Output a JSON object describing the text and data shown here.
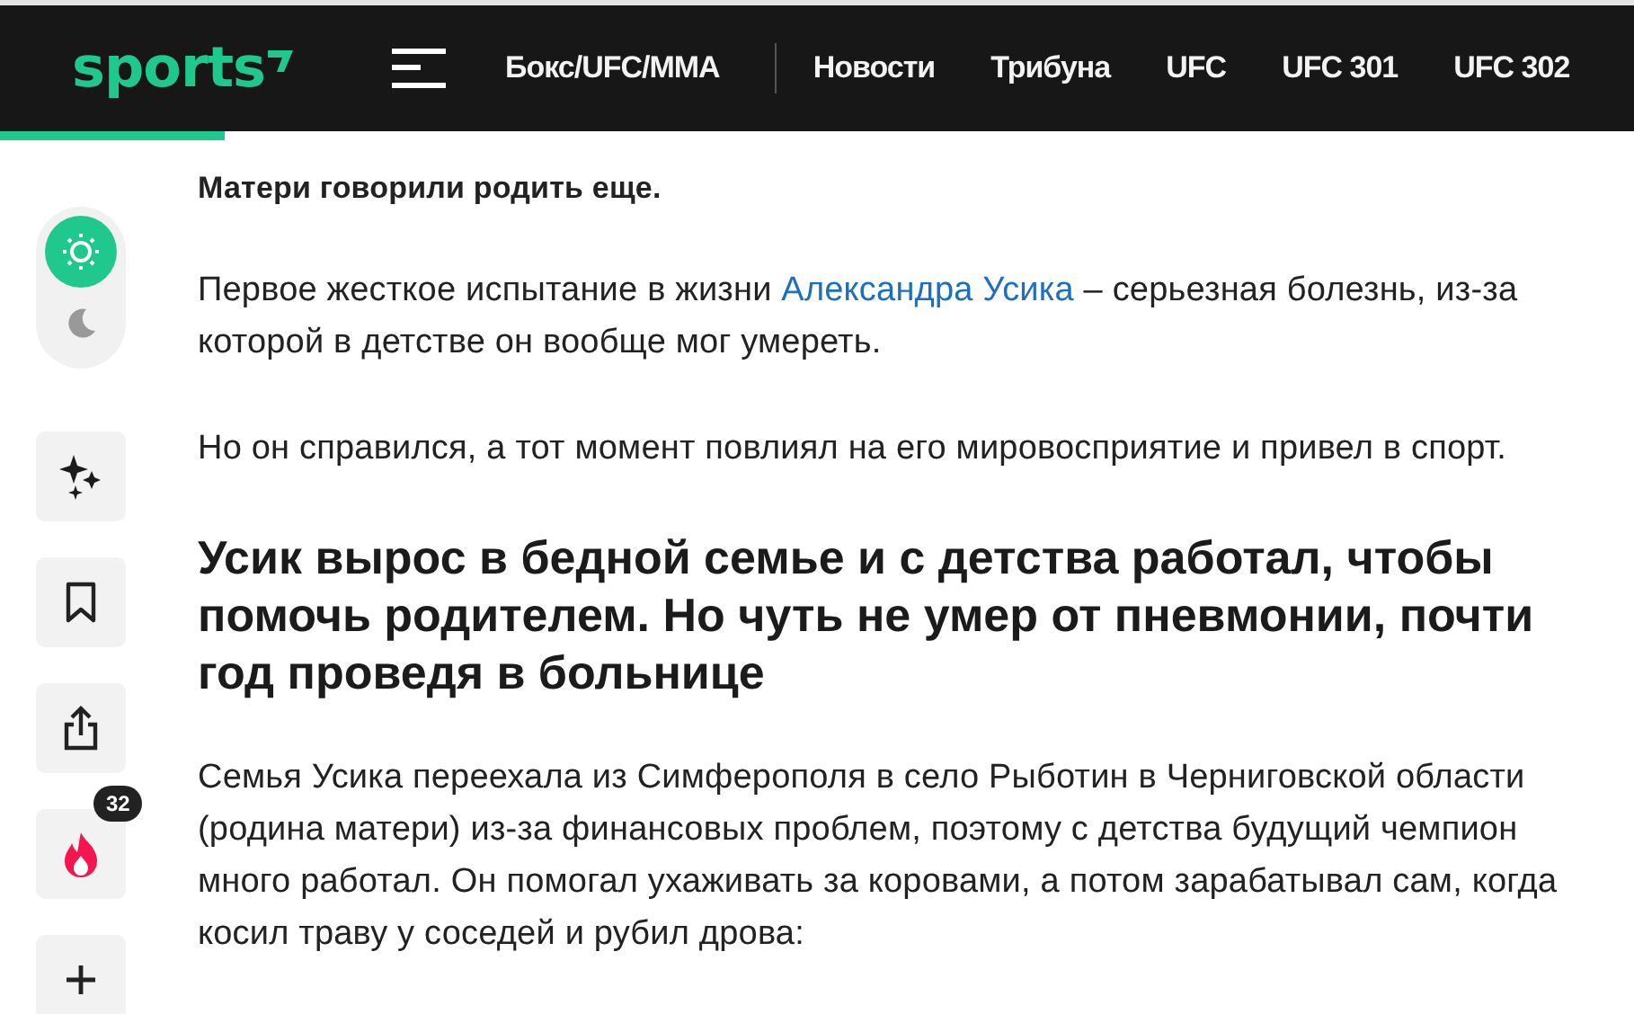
{
  "header": {
    "logo": "sports",
    "nav": [
      {
        "label": "Бокс/UFC/MMA",
        "selected": false
      },
      {
        "label": "Новости",
        "selected": false
      },
      {
        "label": "Трибуна",
        "selected": false
      },
      {
        "label": "UFC",
        "selected": false
      },
      {
        "label": "UFC 301",
        "selected": false
      },
      {
        "label": "UFC 302",
        "selected": false
      }
    ],
    "reading_progress": {
      "level": 0.138
    }
  },
  "sidebar": {
    "theme": [
      {
        "kind": "light",
        "selected": true
      },
      {
        "kind": "dark",
        "selected": false
      }
    ],
    "actions": [
      {
        "kind": "sparkle"
      },
      {
        "kind": "bookmark"
      },
      {
        "kind": "share"
      },
      {
        "kind": "fire",
        "count": "32"
      },
      {
        "kind": "plus"
      }
    ]
  },
  "article": [
    {
      "kind": "lead",
      "parts": [
        {
          "text": "Матери говорили родить еще."
        }
      ]
    },
    {
      "kind": "paragraph",
      "parts": [
        {
          "text": "Первое жесткое испытание в жизни "
        },
        {
          "text": "Александра Усика",
          "link": true
        },
        {
          "text": " – серьезная болезнь, из-за которой в детстве он вообще мог умереть."
        }
      ]
    },
    {
      "kind": "paragraph",
      "parts": [
        {
          "text": "Но он справился, а тот момент повлиял на его мировосприятие и привел в спорт."
        }
      ]
    },
    {
      "kind": "heading",
      "parts": [
        {
          "text": "Усик вырос в бедной семье и с детства работал, чтобы помочь родителем. Но чуть не умер от пневмонии, почти год проведя в больнице"
        }
      ]
    },
    {
      "kind": "paragraph",
      "parts": [
        {
          "text": "Семья Усика переехала из Симферополя в село Рыботин в Черниговской области (родина матери) из-за финансовых проблем, поэтому с детства будущий чемпион много работал. Он помогал ухаживать за коровами, а потом зарабатывал сам, когда косил траву у соседей и рубил дрова:"
        }
      ]
    }
  ]
}
